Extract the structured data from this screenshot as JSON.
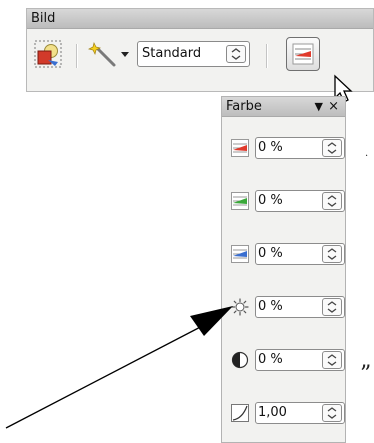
{
  "toolbar": {
    "title": "Bild",
    "icons": [
      "image-filter-icon",
      "wand-icon",
      "dropdown-arrow-icon",
      "color-toggle-icon"
    ],
    "mode_select": {
      "value": "Standard"
    }
  },
  "farbe_panel": {
    "title": "Farbe",
    "close_glyph": "×",
    "menu_glyph": "▼",
    "rows": [
      {
        "icon": "red-channel-icon",
        "value": "0 %"
      },
      {
        "icon": "green-channel-icon",
        "value": "0 %"
      },
      {
        "icon": "blue-channel-icon",
        "value": "0 %"
      },
      {
        "icon": "brightness-icon",
        "value": "0 %"
      },
      {
        "icon": "contrast-icon",
        "value": "0 %"
      },
      {
        "icon": "gamma-icon",
        "value": "1,00"
      }
    ]
  },
  "colors": {
    "red": "#e03a2c",
    "green": "#3aa83a",
    "blue": "#3a6fd0",
    "arrow": "#000000"
  },
  "stray_text": {
    "dot": ".",
    "quote": "”"
  }
}
